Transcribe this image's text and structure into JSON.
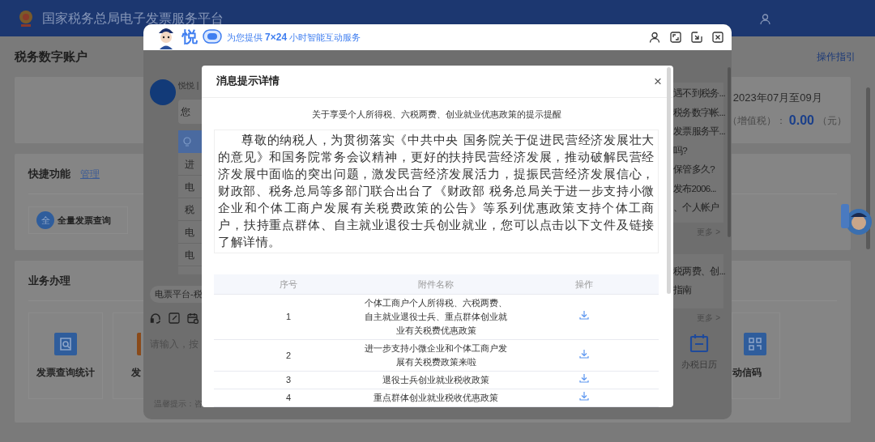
{
  "page": {
    "header_title": "国家税务总局电子发票服务平台",
    "account_title": "税务数字账户",
    "guide_link": "操作指引",
    "period": "2023年07月至09月",
    "amount_label": "（增值税）：",
    "amount": "0.00",
    "amount_unit": "（元）",
    "quick": {
      "title": "快捷功能",
      "manage": "管理",
      "items": [
        {
          "badge": "全",
          "label": "全量发票查询"
        }
      ]
    },
    "business": {
      "title": "业务办理",
      "items": [
        {
          "label": "发票查询统计",
          "kind": "search"
        },
        {
          "label": "发",
          "kind": "orange"
        }
      ],
      "right_item": "动信码"
    }
  },
  "chat": {
    "brand": "悦",
    "tagline": "为您提供 **7×24** 小时智能互动服务",
    "bot_name": "悦悦 |",
    "greeting": "您",
    "menu": [
      "进",
      "电",
      "税",
      "电",
      "电"
    ],
    "channel": "电票平台-税",
    "input_placeholder": "请输入，按",
    "notice": "温馨提示：咨",
    "questions": [
      "遇不到税务...",
      "税务数字帐...",
      "发票服务平...",
      "吗?",
      "保管多久?",
      "发布2006...",
      "、个人帐户"
    ],
    "more": "更多 >",
    "policies": [
      "税两费、创...",
      "指南"
    ],
    "more2": "更多 >",
    "calendar": "办税日历"
  },
  "modal": {
    "title": "消息提示详情",
    "close": "×",
    "subtitle": "关于享受个人所得税、六税两费、创业就业优惠政策的提示提醒",
    "body": "尊敬的纳税人，为贯彻落实《中共中央 国务院关于促进民营经济发展壮大的意见》和国务院常务会议精神，更好的扶持民营经济发展，推动破解民营经济发展中面临的突出问题，激发民营经济发展活力，提振民营经济发展信心，财政部、税务总局等多部门联合出台了《财政部 税务总局关于进一步支持小微企业和个体工商户发展有关税费政策的公告》等系列优惠政策支持个体工商户，扶持重点群体、自主就业退役士兵创业就业，您可以点击以下文件及链接了解详情。",
    "columns": [
      "序号",
      "附件名称",
      "操作"
    ],
    "rows": [
      {
        "no": "1",
        "name": "个体工商户个人所得税、六税两费、自主就业退役士兵、重点群体创业就业有关税费优惠政策"
      },
      {
        "no": "2",
        "name": "进一步支持小微企业和个体工商户发展有关税费政策来啦"
      },
      {
        "no": "3",
        "name": "退役士兵创业就业税收政策"
      },
      {
        "no": "4",
        "name": "重点群体创业就业税收优惠政策"
      }
    ]
  }
}
